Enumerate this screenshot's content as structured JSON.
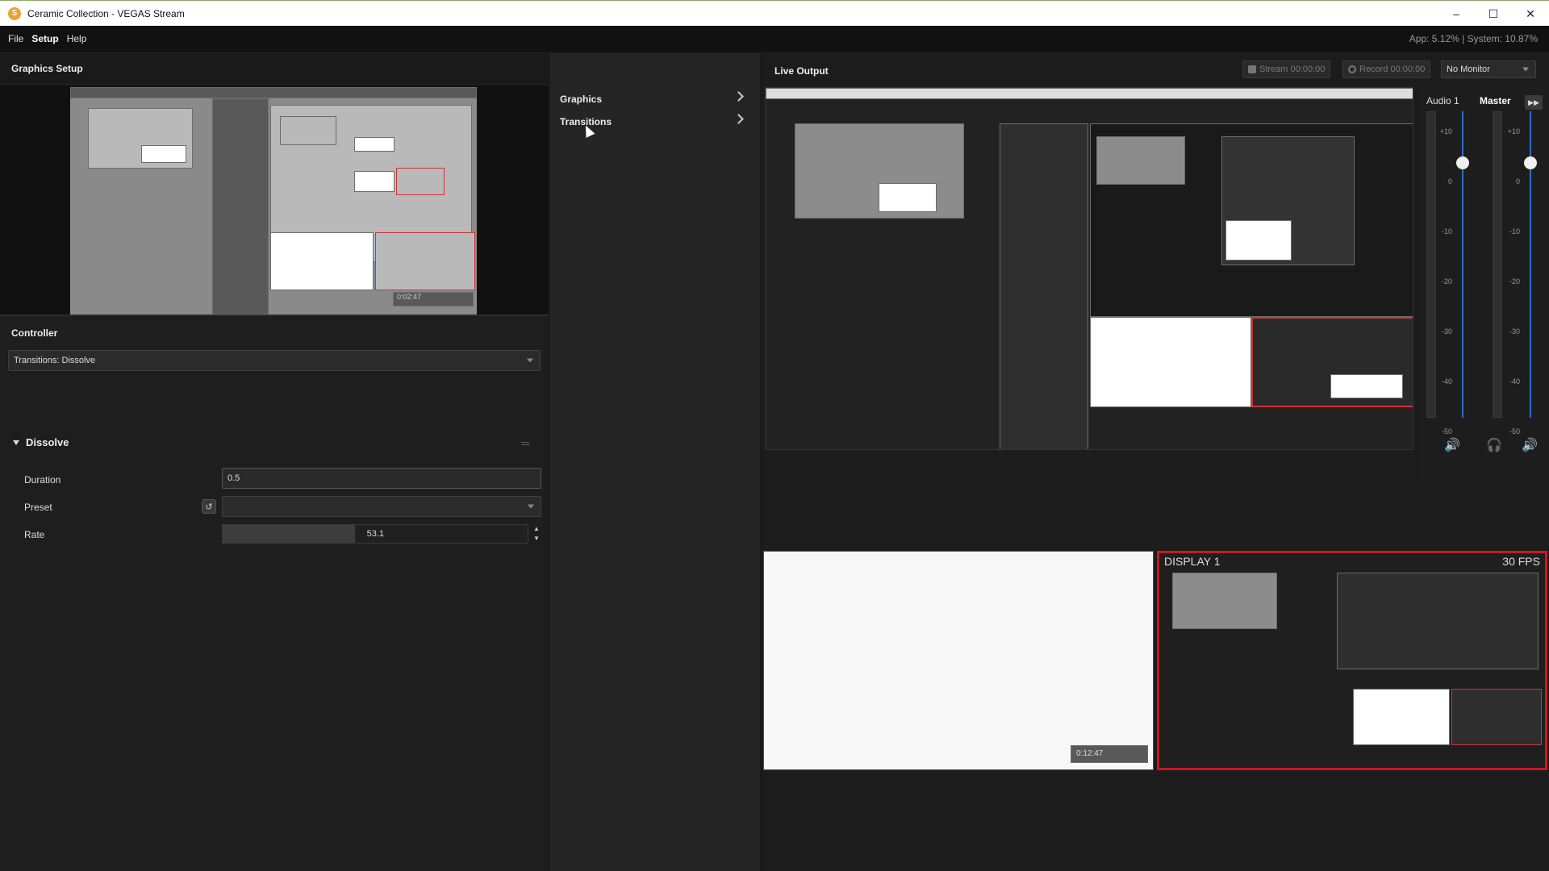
{
  "window": {
    "title": "Ceramic Collection - VEGAS Stream",
    "icon": "app-logo-icon",
    "minimize": "–",
    "maximize": "☐",
    "close": "✕"
  },
  "menu": {
    "items": [
      "File",
      "Setup",
      "Help"
    ],
    "active": "Setup",
    "perf": "App: 5.12% | System: 10.87%"
  },
  "graphics_setup": {
    "title": "Graphics Setup",
    "preview_time": "0:02:47"
  },
  "controller": {
    "title": "Controller",
    "selected": "Transitions: Dissolve",
    "section": "Dissolve",
    "properties": {
      "duration_label": "Duration",
      "duration_value": "0.5",
      "preset_label": "Preset",
      "preset_value": "",
      "rate_label": "Rate",
      "rate_value": "53.1",
      "rate_fraction": 0.434
    }
  },
  "nav": {
    "items": [
      "Graphics",
      "Transitions"
    ]
  },
  "live_output": {
    "title": "Live Output",
    "stream_btn": "Stream 00:00:00",
    "record_btn": "Record 00:00:00",
    "monitor_select": "No Monitor",
    "audio": {
      "ch1": "Audio 1",
      "master": "Master",
      "scale": [
        "+10",
        "0",
        "-10",
        "-20",
        "-30",
        "-40",
        "-50"
      ]
    },
    "thumb_right": {
      "label": "DISPLAY 1",
      "fps": "30 FPS"
    },
    "thumb_left_time": "0:12:47"
  },
  "colors": {
    "accent_red": "#c8181e",
    "fader_blue": "#2e6bcc"
  }
}
